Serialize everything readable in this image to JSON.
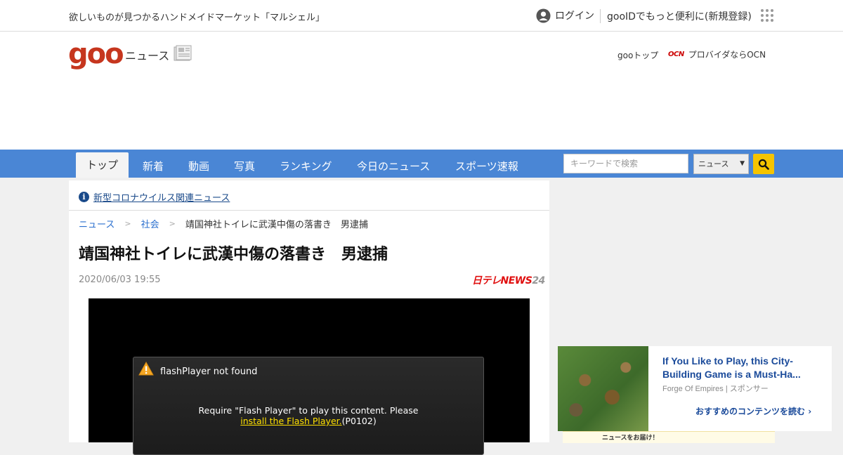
{
  "topbar": {
    "promo_text": "欲しいものが見つかるハンドメイドマーケット「マルシェル」",
    "login_label": "ログイン",
    "register_label": "gooIDでもっと便利に(新規登録)"
  },
  "header": {
    "logo_text": "goo",
    "section_title": "ニュース",
    "goo_top_label": "gooトップ",
    "ocn_logo_text": "OCN",
    "ocn_label": "プロバイダならOCN"
  },
  "nav": {
    "tabs": [
      {
        "label": "トップ"
      },
      {
        "label": "新着"
      },
      {
        "label": "動画"
      },
      {
        "label": "写真"
      },
      {
        "label": "ランキング"
      },
      {
        "label": "今日のニュース"
      },
      {
        "label": "スポーツ速報"
      }
    ],
    "search_placeholder": "キーワードで検索",
    "search_scope": "ニュース"
  },
  "article": {
    "corona_link": "新型コロナウイルス関連ニュース",
    "breadcrumb": [
      "ニュース",
      "社会",
      "靖国神社トイレに武漢中傷の落書き　男逮捕"
    ],
    "breadcrumb_sep": ">",
    "headline": "靖国神社トイレに武漢中傷の落書き　男逮捕",
    "date": "2020/06/03 19:55",
    "source_red": "日テレNEWS",
    "source_grey": "24"
  },
  "player": {
    "dialog_title": "flashPlayer not found",
    "message_line1": "Require \"Flash Player\" to play this content. Please",
    "install_link": "install the Flash Player.",
    "message_code": "(P0102)"
  },
  "ad": {
    "title": "If You Like to Play, this City-Building Game is a Must-Ha...",
    "source": "Forge Of Empires | スポンサー",
    "more_label": "おすすめのコンテンツを読む",
    "banner_text": "ニュースをお届け！"
  },
  "colors": {
    "nav_bg": "#4a86d5",
    "logo_red": "#c6361e",
    "search_button": "#f5c400",
    "link_blue": "#2a6fcf"
  }
}
